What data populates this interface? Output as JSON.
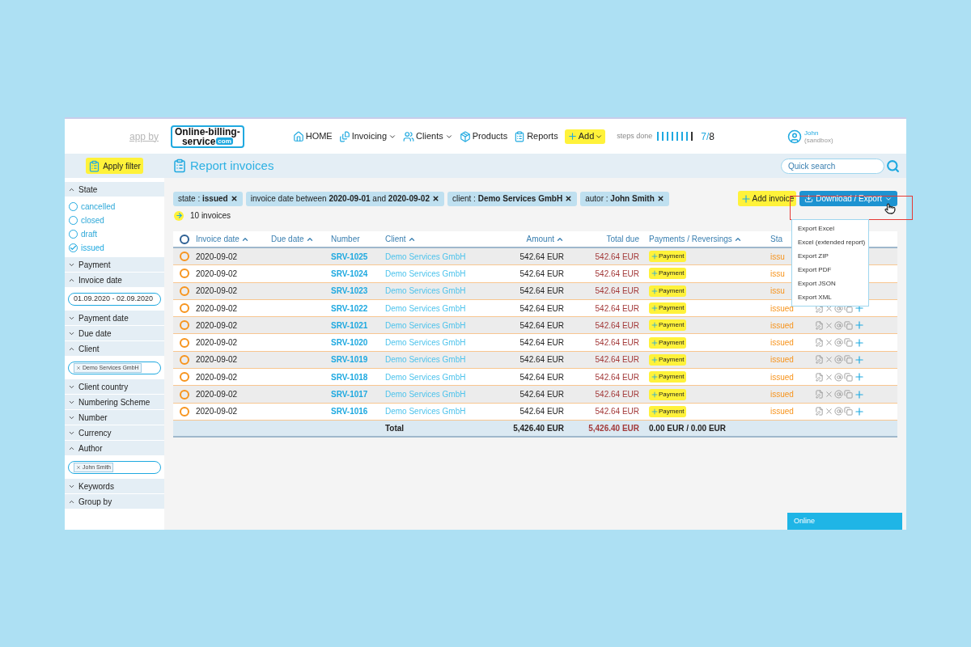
{
  "header": {
    "app_by": "app by",
    "logo": {
      "line1": "Online-billing-",
      "line2": "service",
      "badge": "com"
    },
    "nav": [
      {
        "kind": "home",
        "label": "HOME",
        "caret": false
      },
      {
        "kind": "invoicing",
        "label": "Invoicing",
        "caret": true
      },
      {
        "kind": "clients",
        "label": "Clients",
        "caret": true
      },
      {
        "kind": "products",
        "label": "Products",
        "caret": false
      },
      {
        "kind": "reports",
        "label": "Reports",
        "caret": false
      }
    ],
    "add": {
      "label": "Add"
    },
    "steps": {
      "label": "steps done",
      "level": 0.875,
      "done": "7/",
      "total": "8"
    },
    "user": {
      "name": "John",
      "account": "(sandbox)"
    }
  },
  "sidebar": {
    "apply": "Apply filter",
    "sections": [
      {
        "label": "State",
        "expanded": true,
        "options": [
          {
            "label": "cancelled",
            "checked": false
          },
          {
            "label": "closed",
            "checked": false
          },
          {
            "label": "draft",
            "checked": false
          },
          {
            "label": "issued",
            "checked": true
          }
        ]
      },
      {
        "label": "Payment",
        "expanded": false
      },
      {
        "label": "Invoice date",
        "expanded": true,
        "field": {
          "value": "01.09.2020 - 02.09.2020"
        }
      },
      {
        "label": "Payment date",
        "expanded": false
      },
      {
        "label": "Due date",
        "expanded": false
      },
      {
        "label": "Client",
        "expanded": true,
        "field": {
          "tag": "Demo Services GmbH"
        }
      },
      {
        "label": "Client country",
        "expanded": false
      },
      {
        "label": "Numbering Scheme",
        "expanded": false
      },
      {
        "label": "Number",
        "expanded": false
      },
      {
        "label": "Currency",
        "expanded": false
      },
      {
        "label": "Author",
        "expanded": true,
        "field": {
          "tag": "John Smith"
        }
      },
      {
        "label": "Keywords",
        "expanded": false
      },
      {
        "label": "Group by",
        "expanded": true
      }
    ]
  },
  "page": {
    "title": "Report invoices",
    "search": {
      "placeholder": "Quick search"
    },
    "chips": [
      "state : **issued**",
      "invoice date between **2020-09-01** and **2020-09-02**",
      "client : **Demo Services GmbH**",
      "autor : **John Smith**"
    ],
    "count": "10 invoices",
    "add_invoice": "Add invoice",
    "export": "Download / Export",
    "export_menu": [
      "Export Excel",
      "Excel (extended report)",
      "Export ZIP",
      "Export PDF",
      "Export JSON",
      "Export XML"
    ]
  },
  "table": {
    "columns": [
      {
        "label": "Invoice date",
        "sort": true
      },
      {
        "label": "Due date",
        "sort": true
      },
      {
        "label": "Number",
        "sort": false
      },
      {
        "label": "Client",
        "sort": true
      },
      {
        "label": "Amount",
        "sort": true
      },
      {
        "label": "Total due",
        "sort": false
      },
      {
        "label": "Payments / Reversings",
        "sort": true
      },
      {
        "label": "Sta",
        "sort": false
      }
    ],
    "rows": [
      {
        "date": "2020-09-02",
        "number": "SRV-1025",
        "client": "Demo Services GmbH",
        "amount": "542.64 EUR",
        "due": "542.64 EUR",
        "payment": "Payment",
        "status": "issu",
        "actions_shown": false
      },
      {
        "date": "2020-09-02",
        "number": "SRV-1024",
        "client": "Demo Services GmbH",
        "amount": "542.64 EUR",
        "due": "542.64 EUR",
        "payment": "Payment",
        "status": "issu",
        "actions_shown": false
      },
      {
        "date": "2020-09-02",
        "number": "SRV-1023",
        "client": "Demo Services GmbH",
        "amount": "542.64 EUR",
        "due": "542.64 EUR",
        "payment": "Payment",
        "status": "issu",
        "actions_shown": false
      },
      {
        "date": "2020-09-02",
        "number": "SRV-1022",
        "client": "Demo Services GmbH",
        "amount": "542.64 EUR",
        "due": "542.64 EUR",
        "payment": "Payment",
        "status": "issued",
        "actions_shown": true
      },
      {
        "date": "2020-09-02",
        "number": "SRV-1021",
        "client": "Demo Services GmbH",
        "amount": "542.64 EUR",
        "due": "542.64 EUR",
        "payment": "Payment",
        "status": "issued",
        "actions_shown": true
      },
      {
        "date": "2020-09-02",
        "number": "SRV-1020",
        "client": "Demo Services GmbH",
        "amount": "542.64 EUR",
        "due": "542.64 EUR",
        "payment": "Payment",
        "status": "issued",
        "actions_shown": true
      },
      {
        "date": "2020-09-02",
        "number": "SRV-1019",
        "client": "Demo Services GmbH",
        "amount": "542.64 EUR",
        "due": "542.64 EUR",
        "payment": "Payment",
        "status": "issued",
        "actions_shown": true
      },
      {
        "date": "2020-09-02",
        "number": "SRV-1018",
        "client": "Demo Services GmbH",
        "amount": "542.64 EUR",
        "due": "542.64 EUR",
        "payment": "Payment",
        "status": "issued",
        "actions_shown": true
      },
      {
        "date": "2020-09-02",
        "number": "SRV-1017",
        "client": "Demo Services GmbH",
        "amount": "542.64 EUR",
        "due": "542.64 EUR",
        "payment": "Payment",
        "status": "issued",
        "actions_shown": true
      },
      {
        "date": "2020-09-02",
        "number": "SRV-1016",
        "client": "Demo Services GmbH",
        "amount": "542.64 EUR",
        "due": "542.64 EUR",
        "payment": "Payment",
        "status": "issued",
        "actions_shown": true
      }
    ],
    "total": {
      "label": "Total",
      "amount": "5,426.40 EUR",
      "due": "5,426.40 EUR",
      "payments": "0.00 EUR / 0.00 EUR"
    }
  },
  "chat": {
    "label": "Online"
  }
}
